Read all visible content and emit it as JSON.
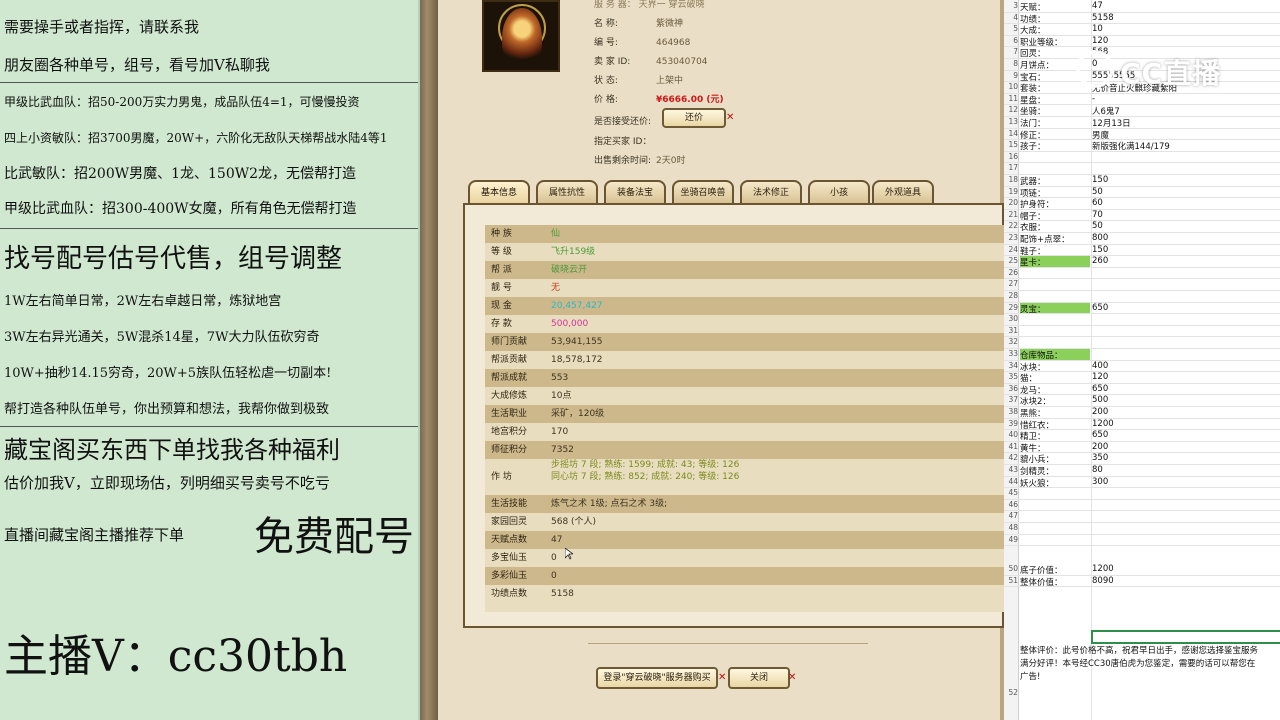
{
  "left_panel": {
    "lines": [
      "需要操手或者指挥，请联系我",
      "朋友圈各种单号，组号，看号加V私聊我",
      "甲级比武血队：招50-200万实力男鬼，成品队伍4=1，可慢慢投资",
      "四上小资敏队：招3700男魔，20W+，六阶化无敌队天梯帮战水陆4等1",
      "比武敏队：招200W男魔、1龙、150W2龙，无偿帮打造",
      "甲级比武血队：招300-400W女魔，所有角色无偿帮打造",
      "找号配号估号代售，组号调整",
      "1W左右简单日常，2W左右卓越日常，炼狱地宫",
      "3W左右异光通关，5W混杀14星，7W大力队伍砍穷奇",
      "10W+抽秒14.15穷奇，20W+5族队伍轻松虐一切副本!",
      "帮打造各种队伍单号，你出预算和想法，我帮你做到极致",
      "藏宝阁买东西下单找我各种福利",
      "估价加我V，立即现场估，列明细买号卖号不吃亏",
      "直播间藏宝阁主播推荐下单",
      "免费配号",
      "主播V：cc30tbh"
    ]
  },
  "game": {
    "server_top": "服 务 器：  天界一 穿云破晓",
    "info": [
      {
        "label": "名        称:",
        "value": "紫微神"
      },
      {
        "label": "编        号:",
        "value": "464968"
      },
      {
        "label": "卖  家  ID:",
        "value": "453040704"
      },
      {
        "label": "状        态:",
        "value": "上架中"
      },
      {
        "label": "价        格:",
        "value": "¥6666.00 (元)"
      },
      {
        "label": "是否接受还价:",
        "value": ""
      },
      {
        "label": "指定买家 ID：",
        "value": ""
      },
      {
        "label": "出售剩余时间:",
        "value": "2天0时"
      }
    ],
    "counter_offer_button": "还价",
    "tabs": [
      "基本信息",
      "属性抗性",
      "装备法宝",
      "坐骑召唤兽",
      "法术修正",
      "小孩",
      "外观道具"
    ],
    "details": [
      {
        "k": "种    族",
        "v": "仙"
      },
      {
        "k": "等    级",
        "v": "飞升159级"
      },
      {
        "k": "帮    派",
        "v": "破晓云开"
      },
      {
        "k": "靓    号",
        "v": "无"
      },
      {
        "k": "现    金",
        "v": "20,457,427"
      },
      {
        "k": "存    款",
        "v": "500,000"
      },
      {
        "k": "师门贡献",
        "v": "53,941,155"
      },
      {
        "k": "帮派贡献",
        "v": "18,578,172"
      },
      {
        "k": "帮派成就",
        "v": "553"
      },
      {
        "k": "大成修炼",
        "v": "10点"
      },
      {
        "k": "生活职业",
        "v": "采矿，120级"
      },
      {
        "k": "地宫积分",
        "v": "170"
      },
      {
        "k": "师征积分",
        "v": "7352"
      },
      {
        "k": "作    坊",
        "v": "步摇坊 7 段;  熟练:  1599;  成就:  43;  等级:  126"
      },
      {
        "k": "",
        "v": "同心坊 7 段;  熟练:  852;  成就:  240;  等级:  126"
      },
      {
        "k": "生活技能",
        "v": "炼气之术 1级; 点石之术 3级;"
      },
      {
        "k": "家园回灵",
        "v": "568 (个人)"
      },
      {
        "k": "天赋点数",
        "v": "47"
      },
      {
        "k": "多宝仙玉",
        "v": "0"
      },
      {
        "k": "多彩仙玉",
        "v": "0"
      },
      {
        "k": "功绩点数",
        "v": "5158"
      }
    ],
    "buy_button": "登录\"穿云破晓\"服务器购买",
    "close_button": "关闭"
  },
  "sheet": {
    "rows": [
      {
        "n": "3",
        "a": "天赋：",
        "b": "47"
      },
      {
        "n": "4",
        "a": "功绩：",
        "b": "5158"
      },
      {
        "n": "5",
        "a": "大成：",
        "b": "10"
      },
      {
        "n": "6",
        "a": "职业等级：",
        "b": "120"
      },
      {
        "n": "7",
        "a": "回灵：",
        "b": "568"
      },
      {
        "n": "8",
        "a": "月饼点：",
        "b": "0"
      },
      {
        "n": "9",
        "a": "宝石：",
        "b": "55555555"
      },
      {
        "n": "10",
        "a": "套装：",
        "b": "无价音止火麒珍藏紫阳"
      },
      {
        "n": "11",
        "a": "星盘：",
        "b": "-"
      },
      {
        "n": "12",
        "a": "坐骑：",
        "b": "人6鬼7"
      },
      {
        "n": "13",
        "a": "法门：",
        "b": "12月13日"
      },
      {
        "n": "14",
        "a": "修正：",
        "b": "男魔"
      },
      {
        "n": "15",
        "a": "孩子：",
        "b": "新版强化满144/179"
      },
      {
        "n": "16",
        "a": "",
        "b": ""
      },
      {
        "n": "17",
        "a": "",
        "b": ""
      },
      {
        "n": "18",
        "a": "武器：",
        "b": "150"
      },
      {
        "n": "19",
        "a": "项链：",
        "b": "50"
      },
      {
        "n": "20",
        "a": "护身符：",
        "b": "60"
      },
      {
        "n": "21",
        "a": "帽子：",
        "b": "70"
      },
      {
        "n": "22",
        "a": "衣服：",
        "b": "50"
      },
      {
        "n": "23",
        "a": "配饰+点翠：",
        "b": "800"
      },
      {
        "n": "24",
        "a": "鞋子：",
        "b": "150"
      },
      {
        "n": "25",
        "a": "星卡：",
        "b": "260"
      },
      {
        "n": "26",
        "a": "",
        "b": ""
      },
      {
        "n": "27",
        "a": "",
        "b": ""
      },
      {
        "n": "28",
        "a": "",
        "b": ""
      },
      {
        "n": "29",
        "a": "灵宝：",
        "b": "650"
      },
      {
        "n": "30",
        "a": "",
        "b": ""
      },
      {
        "n": "31",
        "a": "",
        "b": ""
      },
      {
        "n": "32",
        "a": "",
        "b": ""
      },
      {
        "n": "33",
        "a": "仓库物品：",
        "b": ""
      },
      {
        "n": "34",
        "a": "冰块：",
        "b": "400"
      },
      {
        "n": "35",
        "a": "猫：",
        "b": "120"
      },
      {
        "n": "36",
        "a": "龙马：",
        "b": "650"
      },
      {
        "n": "37",
        "a": "冰块2：",
        "b": "500"
      },
      {
        "n": "38",
        "a": "黑熊：",
        "b": "200"
      },
      {
        "n": "39",
        "a": "惜红衣：",
        "b": "1200"
      },
      {
        "n": "40",
        "a": "精卫：",
        "b": "650"
      },
      {
        "n": "41",
        "a": "黄牛：",
        "b": "200"
      },
      {
        "n": "42",
        "a": "貔小兵：",
        "b": "350"
      },
      {
        "n": "43",
        "a": "剑精灵：",
        "b": "80"
      },
      {
        "n": "44",
        "a": "妖火狼：",
        "b": "300"
      },
      {
        "n": "45",
        "a": "",
        "b": ""
      },
      {
        "n": "46",
        "a": "",
        "b": ""
      },
      {
        "n": "47",
        "a": "",
        "b": ""
      },
      {
        "n": "48",
        "a": "",
        "b": ""
      },
      {
        "n": "49",
        "a": "",
        "b": ""
      },
      {
        "n": "50",
        "a": "底子价值：",
        "b": "1200"
      },
      {
        "n": "51",
        "a": "整体价值：",
        "b": "8090"
      }
    ],
    "comment_line1": "整体评价：此号价格不高，祝君早日出手，感谢您选择鉴宝服务",
    "comment_line2": "满分好评！本号经CC30唐伯虎为您鉴定，需要的话可以帮您在",
    "comment_line3": "广告!",
    "last_row": "52"
  },
  "logo": {
    "text": "CC直播"
  },
  "colors": {
    "green_highlight": "#8bd05a",
    "price_red": "#d01818",
    "panel_bg": "#cfe8cf"
  }
}
